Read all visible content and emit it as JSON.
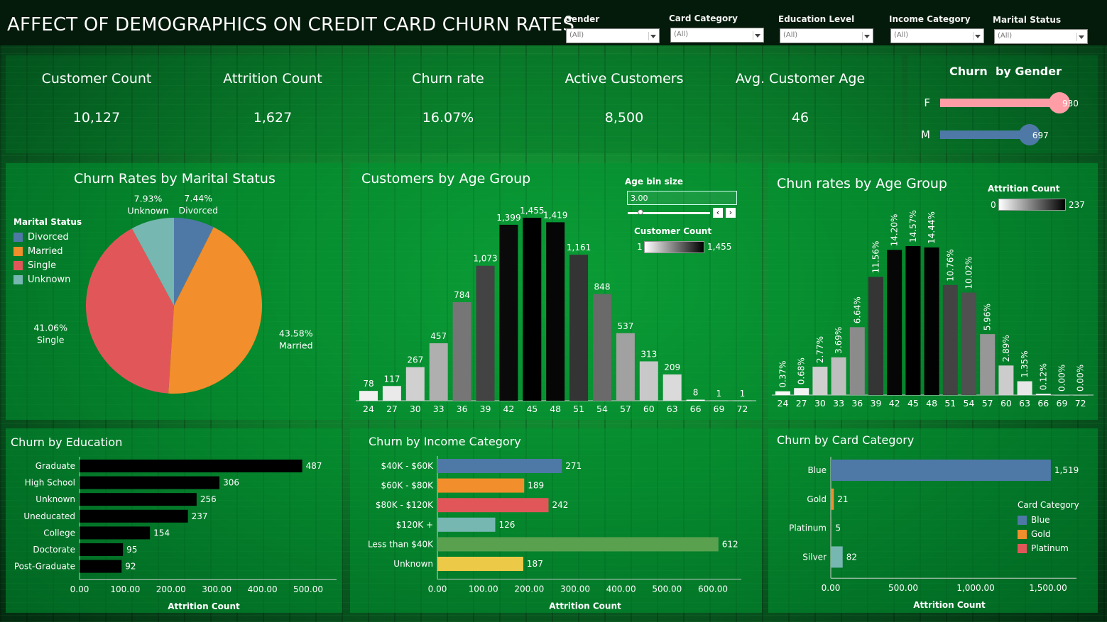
{
  "title": "AFFECT OF DEMOGRAPHICS ON CREDIT CARD  CHURN RATES",
  "filters": [
    {
      "label": "Gender",
      "value": "(All)"
    },
    {
      "label": "Card Category",
      "value": "(All)"
    },
    {
      "label": "Education Level",
      "value": "(All)"
    },
    {
      "label": "Income Category",
      "value": "(All)"
    },
    {
      "label": "Marital Status",
      "value": "(All)"
    }
  ],
  "kpis": [
    {
      "label": "Customer Count",
      "value": "10,127"
    },
    {
      "label": "Attrition Count",
      "value": "1,627"
    },
    {
      "label": "Churn rate",
      "value": "16.07%"
    },
    {
      "label": "Active Customers",
      "value": "8,500"
    },
    {
      "label": "Avg. Customer Age",
      "value": "46"
    }
  ],
  "colors": {
    "blue": "#4e79a7",
    "orange": "#f28e2b",
    "red": "#e15759",
    "teal": "#76b7b2",
    "green": "#59a14f",
    "yellow": "#edc948",
    "pink": "#ff9da7"
  },
  "gender": {
    "title": "Churn  by Gender",
    "items": [
      {
        "label": "F",
        "value": 930,
        "color": "#ff9da7"
      },
      {
        "label": "M",
        "value": 697,
        "color": "#4e79a7"
      }
    ]
  },
  "marital": {
    "legend_title": "Marital Status",
    "chart_data": {
      "type": "pie",
      "title": "Churn Rates by Marital Status",
      "slices": [
        {
          "label": "Divorced",
          "value": 7.44,
          "display": "7.44%",
          "color": "#4e79a7"
        },
        {
          "label": "Married",
          "value": 43.58,
          "display": "43.58%",
          "color": "#f28e2b"
        },
        {
          "label": "Single",
          "value": 41.06,
          "display": "41.06%",
          "color": "#e15759"
        },
        {
          "label": "Unknown",
          "value": 7.93,
          "display": "7.93%",
          "color": "#76b7b2"
        }
      ]
    }
  },
  "age_customers": {
    "bin_label": "Age bin size",
    "bin_value": "3.00",
    "legend_title": "Customer Count",
    "legend_min": "1",
    "legend_max": "1,455",
    "chart_data": {
      "type": "bar",
      "title": "Customers by Age Group",
      "categories": [
        "24",
        "27",
        "30",
        "33",
        "36",
        "39",
        "42",
        "45",
        "48",
        "51",
        "54",
        "57",
        "60",
        "63",
        "66",
        "69",
        "72"
      ],
      "values": [
        78,
        117,
        267,
        457,
        784,
        1073,
        1399,
        1455,
        1419,
        1161,
        848,
        537,
        313,
        209,
        8,
        1,
        1
      ],
      "labels": [
        "78",
        "117",
        "267",
        "457",
        "784",
        "1,073",
        "1,399",
        "1,455",
        "1,419",
        "1,161",
        "848",
        "537",
        "313",
        "209",
        "8",
        "1",
        "1"
      ],
      "ylim": [
        0,
        1455
      ]
    }
  },
  "age_churn": {
    "legend_title": "Attrition Count",
    "legend_min": "0",
    "legend_max": "237",
    "chart_data": {
      "type": "bar",
      "title": "Chun rates by Age Group",
      "categories": [
        "24",
        "27",
        "30",
        "33",
        "36",
        "39",
        "42",
        "45",
        "48",
        "51",
        "54",
        "57",
        "60",
        "63",
        "66",
        "69",
        "72"
      ],
      "values": [
        0.37,
        0.68,
        2.77,
        3.69,
        6.64,
        11.56,
        14.2,
        14.57,
        14.44,
        10.76,
        10.02,
        5.96,
        2.89,
        1.35,
        0.12,
        0.0,
        0.0
      ],
      "labels": [
        "0.37%",
        "0.68%",
        "2.77%",
        "3.69%",
        "6.64%",
        "11.56%",
        "14.20%",
        "14.57%",
        "14.44%",
        "10.76%",
        "10.02%",
        "5.96%",
        "2.89%",
        "1.35%",
        "0.12%",
        "0.00%",
        "0.00%"
      ],
      "ylim": [
        0,
        14.57
      ]
    }
  },
  "education": {
    "chart_data": {
      "type": "bar",
      "orientation": "horizontal",
      "title": "Churn by Education",
      "categories": [
        "Graduate",
        "High School",
        "Unknown",
        "Uneducated",
        "College",
        "Doctorate",
        "Post-Graduate"
      ],
      "values": [
        487,
        306,
        256,
        237,
        154,
        95,
        92
      ],
      "xlabel": "Attrition Count",
      "xticks": [
        "0.00",
        "100.00",
        "200.00",
        "300.00",
        "400.00",
        "500.00"
      ],
      "xlim": [
        0,
        500
      ]
    }
  },
  "income": {
    "chart_data": {
      "type": "bar",
      "orientation": "horizontal",
      "title": "Churn by Income Category",
      "categories": [
        "$40K - $60K",
        "$60K - $80K",
        "$80K - $120K",
        "$120K +",
        "Less than $40K",
        "Unknown"
      ],
      "values": [
        271,
        189,
        242,
        126,
        612,
        187
      ],
      "colors": [
        "#4e79a7",
        "#f28e2b",
        "#e15759",
        "#76b7b2",
        "#59a14f",
        "#edc948"
      ],
      "xlabel": "Attrition Count",
      "xticks": [
        "0.00",
        "100.00",
        "200.00",
        "300.00",
        "400.00",
        "500.00",
        "600.00"
      ],
      "xlim": [
        0,
        600
      ]
    }
  },
  "card": {
    "legend_title": "Card Category",
    "legend": [
      {
        "label": "Blue",
        "color": "#4e79a7"
      },
      {
        "label": "Gold",
        "color": "#f28e2b"
      },
      {
        "label": "Platinum",
        "color": "#e15759"
      }
    ],
    "chart_data": {
      "type": "bar",
      "orientation": "horizontal",
      "title": "Churn by Card Category",
      "categories": [
        "Blue",
        "Gold",
        "Platinum",
        "Silver"
      ],
      "values": [
        1519,
        21,
        5,
        82
      ],
      "labels": [
        "1,519",
        "21",
        "5",
        "82"
      ],
      "colors": [
        "#4e79a7",
        "#f28e2b",
        "#e15759",
        "#76b7b2"
      ],
      "xlabel": "Attrition Count",
      "xticks": [
        "0.00",
        "500.00",
        "1,000.00",
        "1,500.00"
      ],
      "xlim": [
        0,
        1500
      ]
    }
  }
}
